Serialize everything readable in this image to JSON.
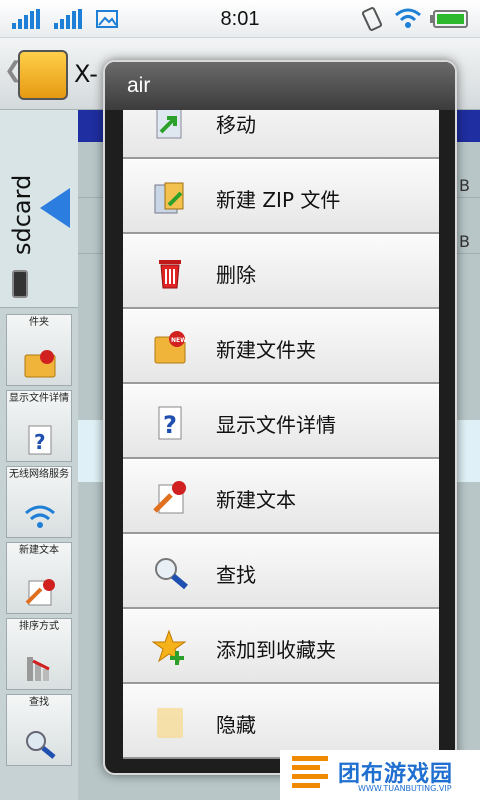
{
  "status_bar": {
    "time": "8:01"
  },
  "app": {
    "title": "X-",
    "back_glyph": "❮"
  },
  "storage": {
    "label": "sdcard"
  },
  "toolbar": {
    "items": [
      {
        "label": "件夹",
        "icon": "new-folder-icon"
      },
      {
        "label": "显示文件详情",
        "icon": "file-details-icon"
      },
      {
        "label": "无线网络服务",
        "icon": "wifi-icon"
      },
      {
        "label": "新建文本",
        "icon": "new-text-icon"
      },
      {
        "label": "排序方式",
        "icon": "sort-icon"
      },
      {
        "label": "查找",
        "icon": "search-icon"
      }
    ]
  },
  "file_list": {
    "sizes": [
      "B",
      "B"
    ]
  },
  "dialog": {
    "title": "air",
    "items": [
      {
        "label": "移动",
        "icon": "move-icon"
      },
      {
        "label": "新建 ZIP 文件",
        "icon": "zip-file-icon"
      },
      {
        "label": "删除",
        "icon": "trash-icon"
      },
      {
        "label": "新建文件夹",
        "icon": "new-folder-icon"
      },
      {
        "label": "显示文件详情",
        "icon": "file-details-icon"
      },
      {
        "label": "新建文本",
        "icon": "new-text-icon"
      },
      {
        "label": "查找",
        "icon": "search-icon"
      },
      {
        "label": "添加到收藏夹",
        "icon": "add-favorite-icon"
      },
      {
        "label": "隐藏",
        "icon": "hide-icon"
      }
    ]
  },
  "watermark": {
    "text": "团布游戏园",
    "sub": "WWW.TUANBUTING.VIP"
  },
  "colors": {
    "accent": "#1e7fd6",
    "battery": "#2eb82e",
    "dialog_bg": "#1e1e1e"
  }
}
